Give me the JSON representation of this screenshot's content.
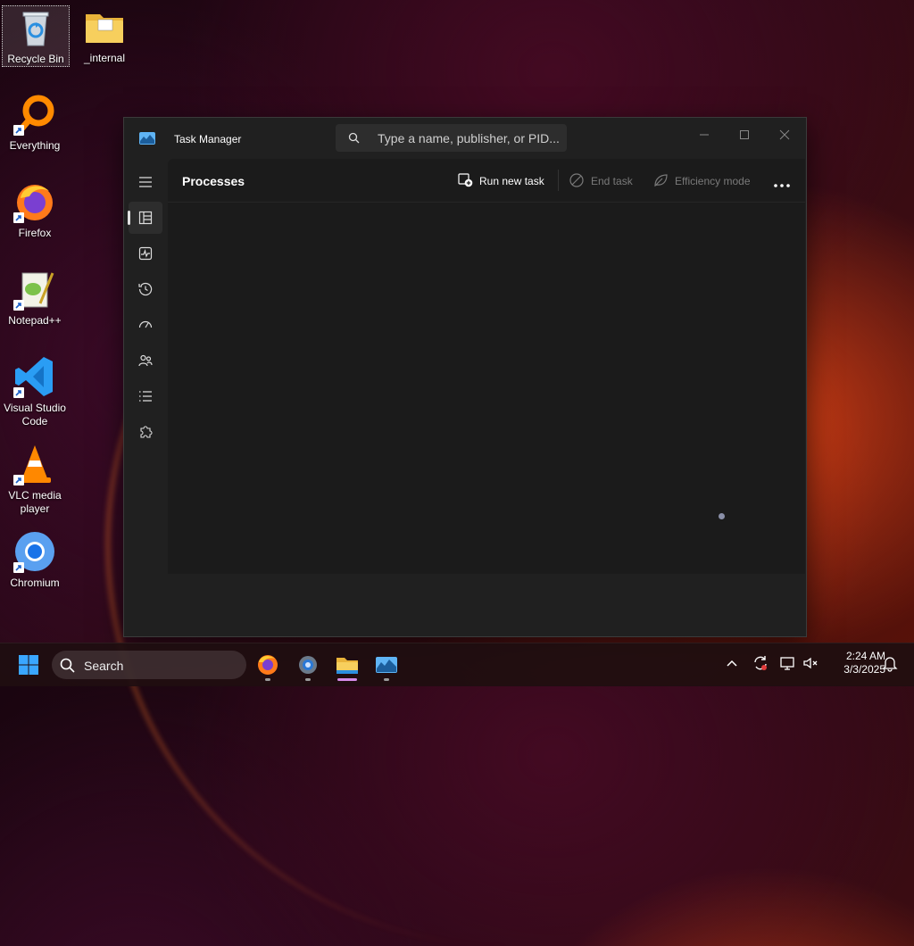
{
  "desktop": {
    "icons": [
      {
        "label": "Recycle Bin",
        "name": "recycle-bin"
      },
      {
        "label": "_internal",
        "name": "internal-folder"
      },
      {
        "label": "Everything",
        "name": "everything"
      },
      {
        "label": "Firefox",
        "name": "firefox"
      },
      {
        "label": "Notepad++",
        "name": "notepad-plus-plus"
      },
      {
        "label": "Visual Studio Code",
        "name": "vscode"
      },
      {
        "label": "VLC media player",
        "name": "vlc"
      },
      {
        "label": "Chromium",
        "name": "chromium"
      }
    ]
  },
  "task_manager": {
    "title": "Task Manager",
    "search_placeholder": "Type a name, publisher, or PID...",
    "page_title": "Processes",
    "toolbar": {
      "run_new_task": "Run new task",
      "end_task": "End task",
      "efficiency_mode": "Efficiency mode"
    },
    "nav": [
      "hamburger-menu",
      "processes",
      "performance",
      "app-history",
      "startup-apps",
      "users",
      "details",
      "services"
    ]
  },
  "taskbar": {
    "search_label": "Search",
    "apps": [
      "firefox",
      "settings",
      "file-explorer",
      "task-manager"
    ],
    "clock": {
      "time": "2:24 AM",
      "date": "3/3/2025"
    }
  },
  "colors": {
    "window_bg": "#202020",
    "content_bg": "#1b1b1b",
    "accent_folder": "#f2c24c",
    "vscode_blue": "#2a9df4"
  }
}
